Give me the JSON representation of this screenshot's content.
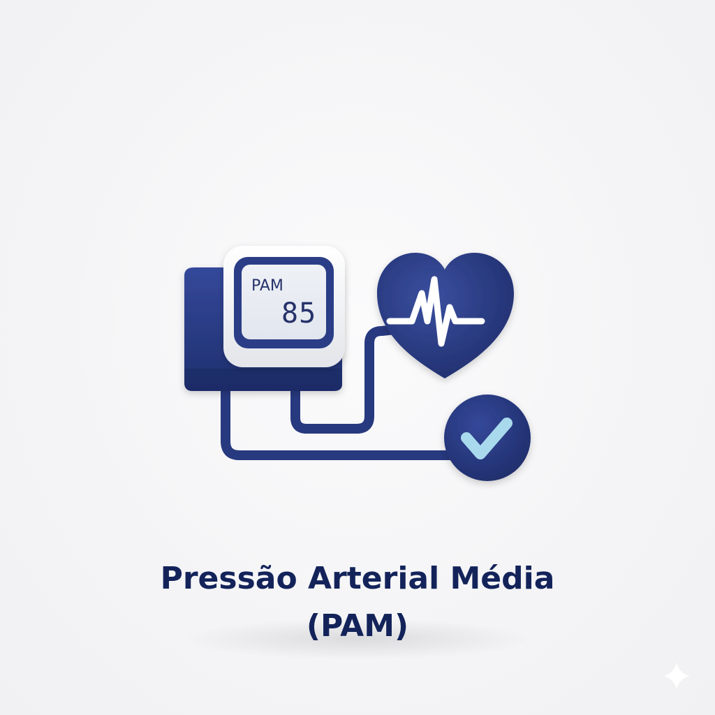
{
  "monitor": {
    "screen_label": "PAM",
    "screen_value": "85"
  },
  "title": {
    "line1": "Pressão Arterial Média",
    "line2": "(PAM)"
  },
  "colors": {
    "navy": "#2a3d86",
    "navy_dark": "#1c2b66",
    "title_text": "#13235a",
    "screen_bg": "#e9ecf3",
    "checkmark": "#a9d9ec",
    "background": "#f6f6f7"
  },
  "icons": [
    "blood-pressure-cuff-icon",
    "monitor-screen-icon",
    "heart-icon",
    "ecg-pulse-icon",
    "check-circle-icon",
    "sparkle-icon"
  ]
}
